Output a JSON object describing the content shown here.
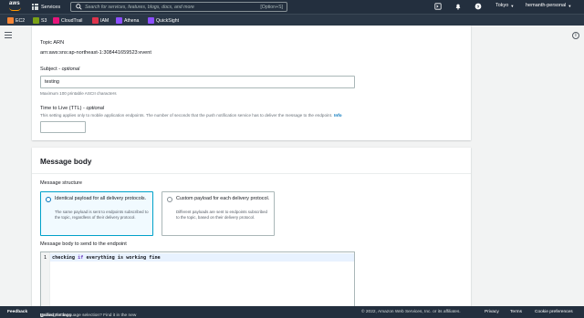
{
  "topnav": {
    "logo_text": "aws",
    "services_label": "Services",
    "search_placeholder": "Search for services, features, blogs, docs, and more",
    "search_shortcut": "[Option+S]",
    "region": "Tokyo",
    "account": "hemanth-personal"
  },
  "favorites": [
    {
      "label": "EC2",
      "color": "#f58536"
    },
    {
      "label": "S3",
      "color": "#7aa116"
    },
    {
      "label": "CloudTrail",
      "color": "#e7157b"
    },
    {
      "label": "IAM",
      "color": "#dd344c"
    },
    {
      "label": "Athena",
      "color": "#8c4fff"
    },
    {
      "label": "QuickSight",
      "color": "#8c4fff"
    }
  ],
  "details": {
    "topic_arn_label": "Topic ARN",
    "topic_arn_value": "arn:aws:sns:ap-northeast-1:308441659523:event",
    "subject_label": "Subject - ",
    "subject_optional": "optional",
    "subject_value": "testing",
    "subject_hint": "Maximum 100 printable ASCII characters",
    "ttl_label": "Time to Live (TTL) - ",
    "ttl_optional": "optional",
    "ttl_hint": "This setting applies only to mobile application endpoints. The number of seconds that the push notification service has to deliver the message to the endpoint.",
    "ttl_info": "Info",
    "ttl_value": ""
  },
  "message_body": {
    "title": "Message body",
    "structure_label": "Message structure",
    "options": [
      {
        "title": "Identical payload for all delivery protocols.",
        "desc": "The same payload is sent to endpoints subscribed to the topic, regardless of their delivery protocol."
      },
      {
        "title": "Custom payload for each delivery protocol.",
        "desc": "Different payloads are sent to endpoints subscribed to the topic, based on their delivery protocol."
      }
    ],
    "editor_label": "Message body to send to the endpoint",
    "editor_line_number": "1",
    "editor_code_1": "checking ",
    "editor_code_kw": "if",
    "editor_code_2": " everything is working fine"
  },
  "footer": {
    "feedback": "Feedback",
    "language_text": "Looking for language selection? Find it in the new",
    "unified_settings": "Unified Settings",
    "copyright": "© 2022, Amazon Web Services, Inc. or its affiliates.",
    "privacy": "Privacy",
    "terms": "Terms",
    "cookie": "Cookie preferences"
  }
}
